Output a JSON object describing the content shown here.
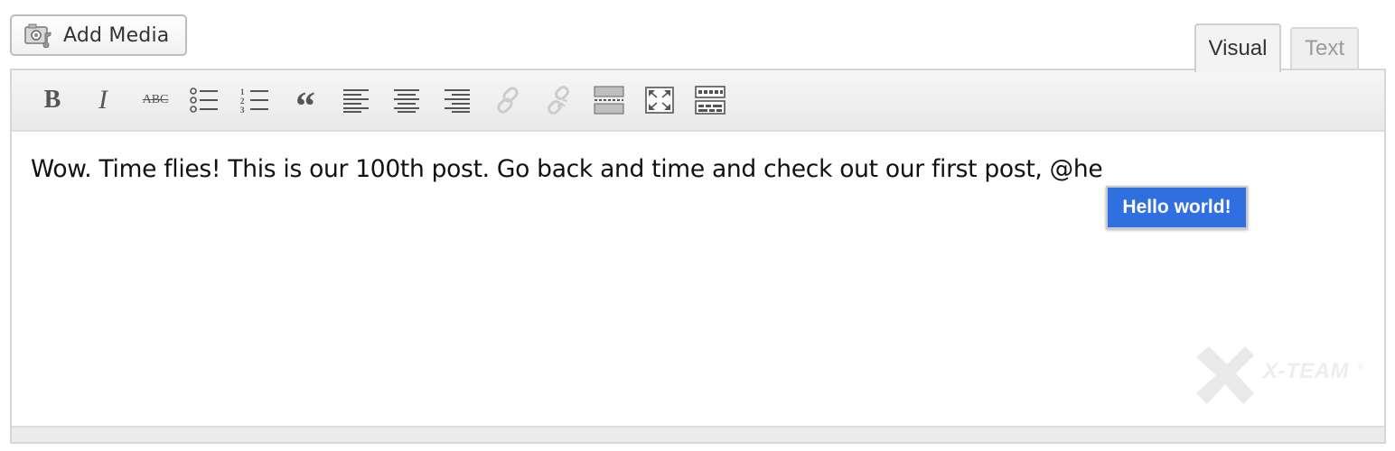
{
  "add_media": {
    "label": "Add Media",
    "icon": "media-camera-icon"
  },
  "tabs": [
    {
      "label": "Visual",
      "active": true
    },
    {
      "label": "Text",
      "active": false
    }
  ],
  "toolbar": {
    "buttons": [
      {
        "name": "bold-icon",
        "glyph": "B"
      },
      {
        "name": "italic-icon",
        "glyph": "I"
      },
      {
        "name": "strikethrough-icon",
        "glyph": "ABC"
      },
      {
        "name": "bullet-list-icon"
      },
      {
        "name": "numbered-list-icon"
      },
      {
        "name": "blockquote-icon",
        "glyph": "“"
      },
      {
        "name": "align-left-icon"
      },
      {
        "name": "align-center-icon"
      },
      {
        "name": "align-right-icon"
      },
      {
        "name": "link-icon",
        "disabled": true
      },
      {
        "name": "unlink-icon",
        "disabled": true
      },
      {
        "name": "read-more-icon"
      },
      {
        "name": "fullscreen-icon"
      },
      {
        "name": "toolbar-toggle-icon"
      }
    ]
  },
  "content": {
    "text": "Wow. Time flies! This is our 100th post. Go back and time and check out our first post, @he"
  },
  "autocomplete": {
    "suggestion": "Hello world!"
  },
  "watermark": {
    "brand": "X-TEAM",
    "mark": "®"
  },
  "colors": {
    "accent": "#2f6fe0",
    "toolbar_icon": "#555555",
    "disabled_icon": "#cccccc"
  }
}
